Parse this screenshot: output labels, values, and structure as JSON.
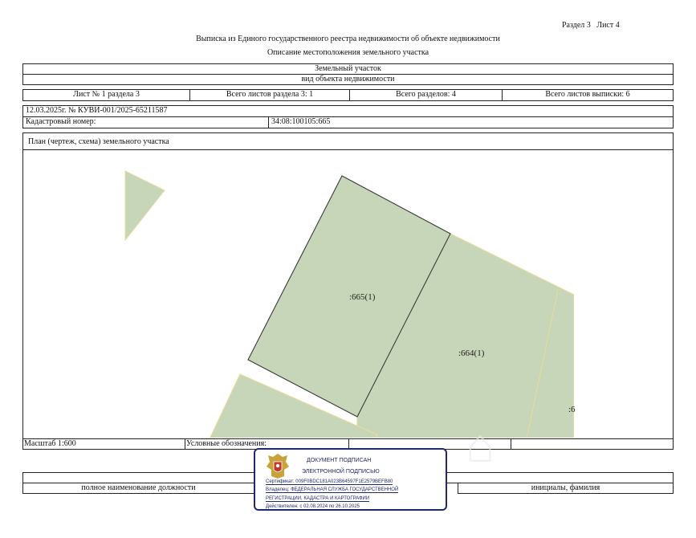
{
  "header": {
    "section_sheet": "Раздел 3   Лист 4",
    "title": "Выписка из Единого государственного реестра недвижимости об объекте недвижимости",
    "subtitle": "Описание местоположения земельного участка"
  },
  "object": {
    "type": "Земельный участок",
    "type_caption": "вид объекта недвижимости"
  },
  "sheets": {
    "sheet_of_section": "Лист № 1 раздела 3",
    "total_sheets_section": "Всего листов раздела 3: 1",
    "total_sections": "Всего разделов: 4",
    "total_sheets_extract": "Всего листов выписки: 6"
  },
  "reg_number": "12.03.2025г. № КУВИ-001/2025-65211587",
  "cadastral": {
    "label": "Кадастровый номер:",
    "value": "34:08:100105:665"
  },
  "plan": {
    "title": "План (чертеж, схема) земельного участка",
    "labels": [
      ":665(1)",
      ":664(1)",
      ":6"
    ]
  },
  "legend": {
    "scale": "Масштаб 1:600",
    "symbols": "Условные обозначения:"
  },
  "footer": {
    "position_caption": "полное наименование должности",
    "name_caption": "инициалы, фамилия"
  },
  "signature": {
    "line1": "ДОКУМЕНТ ПОДПИСАН",
    "line2": "ЭЛЕКТРОННОЙ ПОДПИСЬЮ",
    "cert": "Сертификат: 009F0BDC181A023B64597F1E2579BEFB80",
    "owner1": "Владелец: ФЕДЕРАЛЬНАЯ СЛУЖБА ГОСУДАРСТВЕННОЙ",
    "owner2": "РЕГИСТРАЦИИ, КАДАСТРА И КАРТОГРАФИИ",
    "valid": "Действителен: с 02.08.2024 по 26.10.2025"
  },
  "colors": {
    "parcel_fill": "#c7d6b8",
    "parcel_edge": "#e6dc9c",
    "signature_border": "#1f2a6b"
  }
}
